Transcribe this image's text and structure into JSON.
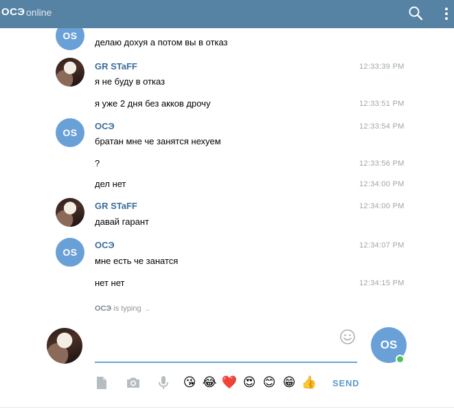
{
  "header": {
    "title": "ОСЭ",
    "status": "online"
  },
  "messages": [
    {
      "author": "",
      "avatar": "OS",
      "text": "делаю дохуя а потом вы в отказ",
      "time": ""
    },
    {
      "author": "GR STaFF",
      "avatar": "photo",
      "text": "я не буду в отказ",
      "time": "12:33:39 PM"
    },
    {
      "author": "",
      "avatar": "",
      "text": "я уже 2 дня без акков дрочу",
      "time": "12:33:51 PM"
    },
    {
      "author": "ОСЭ",
      "avatar": "OS",
      "text": "братан мне че занятся нехуем",
      "time": "12:33:54 PM"
    },
    {
      "author": "",
      "avatar": "",
      "text": "?",
      "time": "12:33:56 PM"
    },
    {
      "author": "",
      "avatar": "",
      "text": "дел нет",
      "time": "12:34:00 PM"
    },
    {
      "author": "GR STaFF",
      "avatar": "photo",
      "text": "давай гарант",
      "time": "12:34:00 PM"
    },
    {
      "author": "ОСЭ",
      "avatar": "OS",
      "text": "мне есть че занатся",
      "time": "12:34:07 PM"
    },
    {
      "author": "",
      "avatar": "",
      "text": "нет нет",
      "time": "12:34:15 PM"
    }
  ],
  "typing": {
    "name": "ОСЭ",
    "text": "is typing",
    "dots": ".."
  },
  "compose": {
    "value": "",
    "placeholder": "",
    "send_label": "SEND",
    "peer_initials": "OS",
    "emojis": [
      "😘",
      "😂",
      "❤️",
      "😍",
      "😊",
      "😁",
      "👍"
    ]
  },
  "colors": {
    "header": "#5682a3",
    "accent": "#6aa0d8",
    "author": "#3a6d99",
    "online": "#4bc25a"
  },
  "icons": [
    "search-icon",
    "more-vertical-icon",
    "emoji-smile-icon",
    "file-icon",
    "camera-icon",
    "microphone-icon"
  ]
}
